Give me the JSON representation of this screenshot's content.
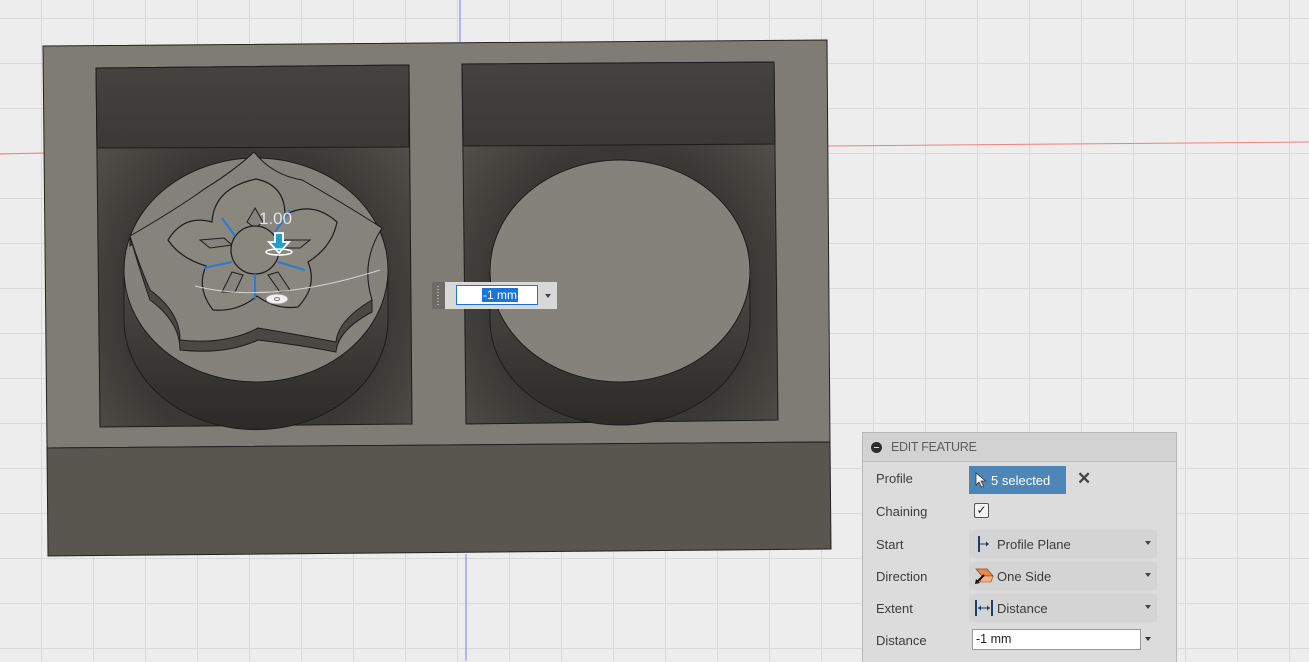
{
  "viewport": {
    "axis_colors": {
      "x_axis": "#f07f7f",
      "y_axis": "#7f7ff0"
    },
    "model_colors": {
      "top_face": "#7f7c75",
      "front_face": "#58564f",
      "cavity": "#3e3c38",
      "highlight": "#1e73d8"
    },
    "dimension_label": "1.00",
    "manipulator_icon": "down-arrow-icon",
    "inline_distance_input": {
      "value": "-1 mm"
    }
  },
  "panel": {
    "title": "EDIT FEATURE",
    "rows": {
      "profile": {
        "label": "Profile",
        "value": "5 selected",
        "clear": "✕"
      },
      "chaining": {
        "label": "Chaining",
        "checked": true,
        "mark": "✓"
      },
      "start": {
        "label": "Start",
        "value": "Profile Plane"
      },
      "direction": {
        "label": "Direction",
        "value": "One Side"
      },
      "extent": {
        "label": "Extent",
        "value": "Distance"
      },
      "distance": {
        "label": "Distance",
        "value": "-1 mm"
      }
    }
  }
}
